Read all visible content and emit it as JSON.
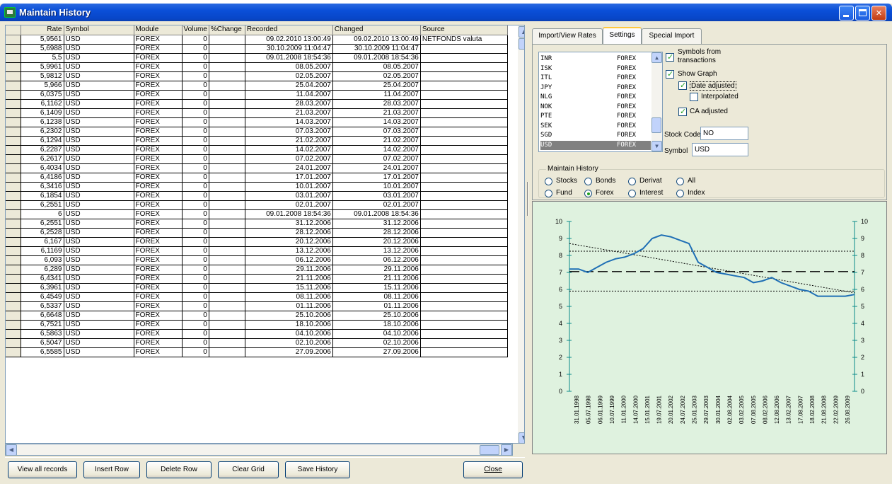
{
  "window": {
    "title": "Maintain History",
    "buttons": {
      "minimize": "_",
      "maximize": "□",
      "close": "✕"
    }
  },
  "grid": {
    "columns": [
      "Rate",
      "Symbol",
      "Module",
      "Volume",
      "%Change",
      "Recorded",
      "Changed",
      "Source"
    ],
    "rows": [
      [
        "5,9561",
        "USD",
        "FOREX",
        "0",
        "",
        "09.02.2010 13:00:49",
        "09.02.2010 13:00:49",
        "NETFONDS valuta"
      ],
      [
        "5,6988",
        "USD",
        "FOREX",
        "0",
        "",
        "30.10.2009 11:04:47",
        "30.10.2009 11:04:47",
        ""
      ],
      [
        "5,5",
        "USD",
        "FOREX",
        "0",
        "",
        "09.01.2008 18:54:36",
        "09.01.2008 18:54:36",
        ""
      ],
      [
        "5,9961",
        "USD",
        "FOREX",
        "0",
        "",
        "08.05.2007",
        "08.05.2007",
        ""
      ],
      [
        "5,9812",
        "USD",
        "FOREX",
        "0",
        "",
        "02.05.2007",
        "02.05.2007",
        ""
      ],
      [
        "5,966",
        "USD",
        "FOREX",
        "0",
        "",
        "25.04.2007",
        "25.04.2007",
        ""
      ],
      [
        "6,0375",
        "USD",
        "FOREX",
        "0",
        "",
        "11.04.2007",
        "11.04.2007",
        ""
      ],
      [
        "6,1162",
        "USD",
        "FOREX",
        "0",
        "",
        "28.03.2007",
        "28.03.2007",
        ""
      ],
      [
        "6,1409",
        "USD",
        "FOREX",
        "0",
        "",
        "21.03.2007",
        "21.03.2007",
        ""
      ],
      [
        "6,1238",
        "USD",
        "FOREX",
        "0",
        "",
        "14.03.2007",
        "14.03.2007",
        ""
      ],
      [
        "6,2302",
        "USD",
        "FOREX",
        "0",
        "",
        "07.03.2007",
        "07.03.2007",
        ""
      ],
      [
        "6,1294",
        "USD",
        "FOREX",
        "0",
        "",
        "21.02.2007",
        "21.02.2007",
        ""
      ],
      [
        "6,2287",
        "USD",
        "FOREX",
        "0",
        "",
        "14.02.2007",
        "14.02.2007",
        ""
      ],
      [
        "6,2617",
        "USD",
        "FOREX",
        "0",
        "",
        "07.02.2007",
        "07.02.2007",
        ""
      ],
      [
        "6,4034",
        "USD",
        "FOREX",
        "0",
        "",
        "24.01.2007",
        "24.01.2007",
        ""
      ],
      [
        "6,4186",
        "USD",
        "FOREX",
        "0",
        "",
        "17.01.2007",
        "17.01.2007",
        ""
      ],
      [
        "6,3416",
        "USD",
        "FOREX",
        "0",
        "",
        "10.01.2007",
        "10.01.2007",
        ""
      ],
      [
        "6,1854",
        "USD",
        "FOREX",
        "0",
        "",
        "03.01.2007",
        "03.01.2007",
        ""
      ],
      [
        "6,2551",
        "USD",
        "FOREX",
        "0",
        "",
        "02.01.2007",
        "02.01.2007",
        ""
      ],
      [
        "6",
        "USD",
        "FOREX",
        "0",
        "",
        "09.01.2008 18:54:36",
        "09.01.2008 18:54:36",
        ""
      ],
      [
        "6,2551",
        "USD",
        "FOREX",
        "0",
        "",
        "31.12.2006",
        "31.12.2006",
        ""
      ],
      [
        "6,2528",
        "USD",
        "FOREX",
        "0",
        "",
        "28.12.2006",
        "28.12.2006",
        ""
      ],
      [
        "6,167",
        "USD",
        "FOREX",
        "0",
        "",
        "20.12.2006",
        "20.12.2006",
        ""
      ],
      [
        "6,1169",
        "USD",
        "FOREX",
        "0",
        "",
        "13.12.2006",
        "13.12.2006",
        ""
      ],
      [
        "6,093",
        "USD",
        "FOREX",
        "0",
        "",
        "06.12.2006",
        "06.12.2006",
        ""
      ],
      [
        "6,289",
        "USD",
        "FOREX",
        "0",
        "",
        "29.11.2006",
        "29.11.2006",
        ""
      ],
      [
        "6,4341",
        "USD",
        "FOREX",
        "0",
        "",
        "21.11.2006",
        "21.11.2006",
        ""
      ],
      [
        "6,3961",
        "USD",
        "FOREX",
        "0",
        "",
        "15.11.2006",
        "15.11.2006",
        ""
      ],
      [
        "6,4549",
        "USD",
        "FOREX",
        "0",
        "",
        "08.11.2006",
        "08.11.2006",
        ""
      ],
      [
        "6,5337",
        "USD",
        "FOREX",
        "0",
        "",
        "01.11.2006",
        "01.11.2006",
        ""
      ],
      [
        "6,6648",
        "USD",
        "FOREX",
        "0",
        "",
        "25.10.2006",
        "25.10.2006",
        ""
      ],
      [
        "6,7521",
        "USD",
        "FOREX",
        "0",
        "",
        "18.10.2006",
        "18.10.2006",
        ""
      ],
      [
        "6,5863",
        "USD",
        "FOREX",
        "0",
        "",
        "04.10.2006",
        "04.10.2006",
        ""
      ],
      [
        "6,5047",
        "USD",
        "FOREX",
        "0",
        "",
        "02.10.2006",
        "02.10.2006",
        ""
      ],
      [
        "6,5585",
        "USD",
        "FOREX",
        "0",
        "",
        "27.09.2006",
        "27.09.2006",
        ""
      ]
    ]
  },
  "buttons": {
    "view_all": "View all records",
    "insert_row": "Insert Row",
    "delete_row": "Delete Row",
    "clear_grid": "Clear Grid",
    "save_history": "Save History",
    "close": "Close"
  },
  "tabs": [
    "Import/View Rates",
    "Settings",
    "Special Import"
  ],
  "symbol_list": [
    {
      "code": "INR",
      "module": "FOREX"
    },
    {
      "code": "ISK",
      "module": "FOREX"
    },
    {
      "code": "ITL",
      "module": "FOREX"
    },
    {
      "code": "JPY",
      "module": "FOREX"
    },
    {
      "code": "NLG",
      "module": "FOREX"
    },
    {
      "code": "NOK",
      "module": "FOREX"
    },
    {
      "code": "PTE",
      "module": "FOREX"
    },
    {
      "code": "SEK",
      "module": "FOREX"
    },
    {
      "code": "SGD",
      "module": "FOREX"
    },
    {
      "code": "USD",
      "module": "FOREX",
      "selected": true
    }
  ],
  "options": {
    "symbols_from_transactions": {
      "label1": "Symbols from",
      "label2": "transactions",
      "checked": true
    },
    "show_graph": {
      "label": "Show Graph",
      "checked": true
    },
    "date_adjusted": {
      "label": "Date adjusted",
      "checked": true
    },
    "interpolated": {
      "label": "Interpolated",
      "checked": false
    },
    "ca_adjusted": {
      "label": "CA adjusted",
      "checked": true
    }
  },
  "stock_code": {
    "label": "Stock Code",
    "value": "NO"
  },
  "symbol": {
    "label": "Symbol",
    "value": "USD"
  },
  "maintain_history": {
    "title": "Maintain History",
    "radios": [
      {
        "label": "Stocks",
        "checked": false
      },
      {
        "label": "Bonds",
        "checked": false
      },
      {
        "label": "Derivat",
        "checked": false
      },
      {
        "label": "All",
        "checked": false
      },
      {
        "label": "Fund",
        "checked": false
      },
      {
        "label": "Forex",
        "checked": true
      },
      {
        "label": "Interest",
        "checked": false
      },
      {
        "label": "Index",
        "checked": false
      }
    ]
  },
  "chart_data": {
    "type": "line",
    "ylim": [
      0,
      10
    ],
    "yticks": [
      0,
      1,
      2,
      3,
      4,
      5,
      6,
      7,
      8,
      9,
      10
    ],
    "xticks": [
      "31.01.1998",
      "05.07.1998",
      "06.01.1999",
      "10.07.1999",
      "11.01.2000",
      "14.07.2000",
      "15.01.2001",
      "19.07.2001",
      "20.01.2002",
      "24.07.2002",
      "25.01.2003",
      "29.07.2003",
      "30.01.2004",
      "02.08.2004",
      "03.02.2005",
      "07.08.2005",
      "08.02.2006",
      "12.08.2006",
      "13.02.2007",
      "17.08.2007",
      "18.02.2008",
      "21.08.2008",
      "22.02.2009",
      "26.08.2009"
    ],
    "series": [
      {
        "values": [
          7.2,
          7.2,
          7.0,
          7.3,
          7.6,
          7.8,
          7.9,
          8.1,
          8.4,
          9.0,
          9.2,
          9.1,
          8.9,
          8.7,
          7.6,
          7.3,
          7.0,
          6.9,
          6.8,
          6.7,
          6.4,
          6.5,
          6.7,
          6.4,
          6.2,
          6.0,
          5.9,
          5.6,
          5.6,
          5.6,
          5.6,
          5.7
        ]
      }
    ],
    "reference_lines": [
      {
        "style": "dashed",
        "value": 7.05
      },
      {
        "style": "dotted",
        "value": 8.25
      },
      {
        "style": "dotted",
        "value": 5.9
      }
    ],
    "trend_line": {
      "style": "dotted",
      "from": 8.7,
      "to": 5.8
    },
    "grid": false,
    "colors": {
      "series": "#1f6fb5",
      "background": "#dff2df",
      "axis": "#0a8a8a"
    }
  }
}
